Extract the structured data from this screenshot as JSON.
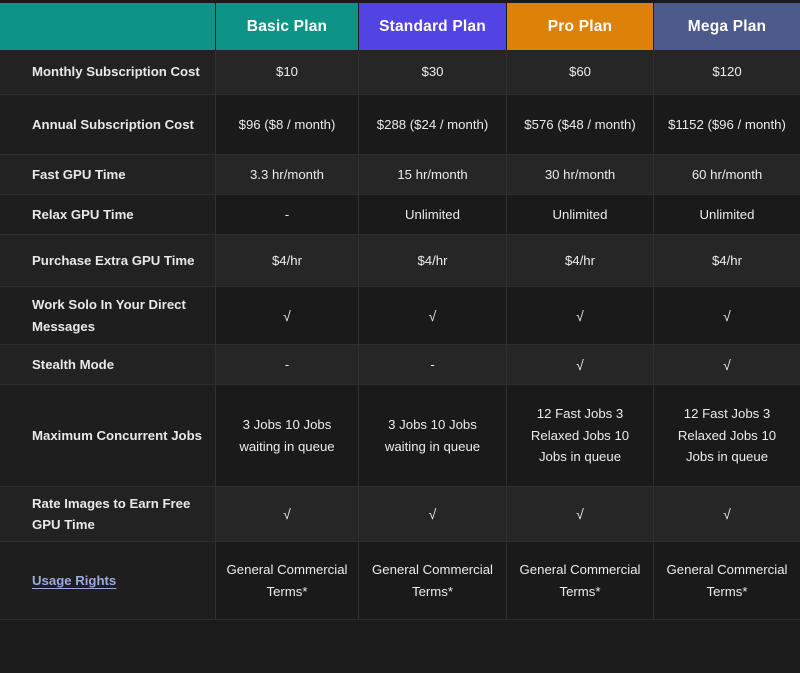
{
  "table": {
    "corner_label": "",
    "columns": [
      {
        "label": "Basic Plan",
        "color": "#0e9486"
      },
      {
        "label": "Standard Plan",
        "color": "#5243e5"
      },
      {
        "label": "Pro Plan",
        "color": "#dc8208"
      },
      {
        "label": "Mega Plan",
        "color": "#4c5b8c"
      }
    ],
    "link_color": "#9aaadf",
    "rows": [
      {
        "label": "Monthly Subscription Cost",
        "label_is_link": false,
        "values": [
          "$10",
          "$30",
          "$60",
          "$120"
        ]
      },
      {
        "label": "Annual Subscription Cost",
        "label_is_link": false,
        "values": [
          "$96\n($8 / month)",
          "$288\n($24 / month)",
          "$576\n($48 / month)",
          "$1152\n($96 / month)"
        ]
      },
      {
        "label": "Fast GPU Time",
        "label_is_link": false,
        "values": [
          "3.3 hr/month",
          "15 hr/month",
          "30 hr/month",
          "60 hr/month"
        ]
      },
      {
        "label": "Relax GPU Time",
        "label_is_link": false,
        "values": [
          "-",
          "Unlimited",
          "Unlimited",
          "Unlimited"
        ]
      },
      {
        "label": "Purchase Extra GPU Time",
        "label_is_link": false,
        "values": [
          "$4/hr",
          "$4/hr",
          "$4/hr",
          "$4/hr"
        ]
      },
      {
        "label": "Work Solo In Your Direct Messages",
        "label_is_link": false,
        "values": [
          "√",
          "√",
          "√",
          "√"
        ]
      },
      {
        "label": "Stealth Mode",
        "label_is_link": false,
        "values": [
          "-",
          "-",
          "√",
          "√"
        ]
      },
      {
        "label": "Maximum Concurrent Jobs",
        "label_is_link": false,
        "values": [
          "3 Jobs\n10 Jobs waiting in queue",
          "3 Jobs\n10 Jobs waiting in queue",
          "12 Fast Jobs\n3 Relaxed Jobs\n10 Jobs in queue",
          "12 Fast Jobs\n3 Relaxed Jobs\n10 Jobs in queue"
        ]
      },
      {
        "label": "Rate Images to Earn Free GPU Time",
        "label_is_link": false,
        "values": [
          "√",
          "√",
          "√",
          "√"
        ]
      },
      {
        "label": "Usage Rights",
        "label_is_link": true,
        "values": [
          "General Commercial Terms*",
          "General Commercial Terms*",
          "General Commercial Terms*",
          "General Commercial Terms*"
        ]
      }
    ]
  }
}
